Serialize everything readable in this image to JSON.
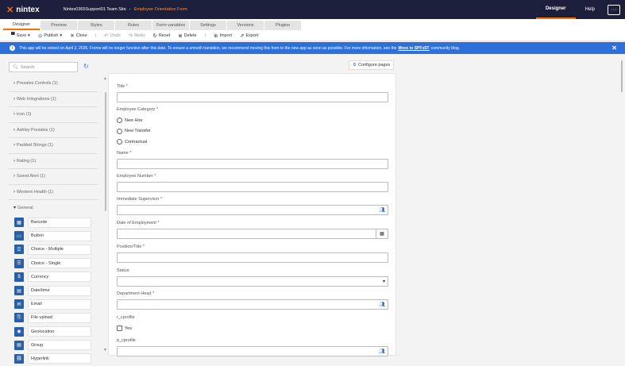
{
  "topbar": {
    "logo": "nintex",
    "breadcrumb": [
      "Nintex0365Support01 Team Site",
      "Employee Orientation Form"
    ],
    "links": [
      {
        "label": "Designer",
        "active": true
      },
      {
        "label": "Help",
        "active": false
      }
    ],
    "more_label": "···"
  },
  "tabs": [
    {
      "label": "Designer",
      "active": true
    },
    {
      "label": "Preview",
      "active": false
    },
    {
      "label": "Styles",
      "active": false
    },
    {
      "label": "Rules",
      "active": false
    },
    {
      "label": "Form variables",
      "active": false
    },
    {
      "label": "Settings",
      "active": false
    },
    {
      "label": "Versions",
      "active": false
    },
    {
      "label": "Plugins",
      "active": false
    }
  ],
  "toolbar": {
    "save_label": "Save",
    "publish_label": "Publish",
    "close_label": "Close",
    "undo_label": "Undo",
    "redo_label": "Redo",
    "reset_label": "Reset",
    "delete_label": "Delete",
    "import_label": "Import",
    "export_label": "Export"
  },
  "banner": {
    "text_before": "This app will be retired on April 2, 2026. Forms will no longer function after this date. To ensure a smooth transition, we recommend moving this form to the new app as soon as possible. For more information, see the",
    "link": "Move to SPFxST",
    "text_after": "community blog."
  },
  "sidebar": {
    "search_placeholder": "Search",
    "groups": [
      "Presales Controls (1)",
      "Web Integrations (1)",
      "icon (1)",
      "Ashley Presales (1)",
      "Padded Strings (1)",
      "Rating (1)",
      "Sweet Alert (1)",
      "Western Health (1)"
    ],
    "general_label": "General",
    "controls": [
      {
        "label": "Barcode",
        "icon": "▦"
      },
      {
        "label": "Button",
        "icon": "▭"
      },
      {
        "label": "Choice - Multiple",
        "icon": "☰"
      },
      {
        "label": "Choice - Single",
        "icon": "☰"
      },
      {
        "label": "Currency",
        "icon": "$"
      },
      {
        "label": "Date/time",
        "icon": "▤"
      },
      {
        "label": "Email",
        "icon": "✉"
      },
      {
        "label": "File upload",
        "icon": "⎘"
      },
      {
        "label": "Geolocation",
        "icon": "◉"
      },
      {
        "label": "Group",
        "icon": "▤"
      },
      {
        "label": "Hyperlink",
        "icon": "⛓"
      }
    ]
  },
  "configure_label": "Configure pages",
  "form": {
    "title_label": "Title",
    "category_label": "Employee Category",
    "category_options": [
      "New Hire",
      "New Transfer",
      "Contractual"
    ],
    "name_label": "Name",
    "number_label": "Employee Number",
    "supervisor_label": "Immediate Supervisor",
    "doe_label": "Date of Employment",
    "position_label": "Position/Title",
    "status_label": "Status",
    "dept_head_label": "Department Head",
    "r_profile_label": "r_cprofile",
    "r_profile_option": "Yes",
    "p_profile_label": "p_cprofile"
  }
}
